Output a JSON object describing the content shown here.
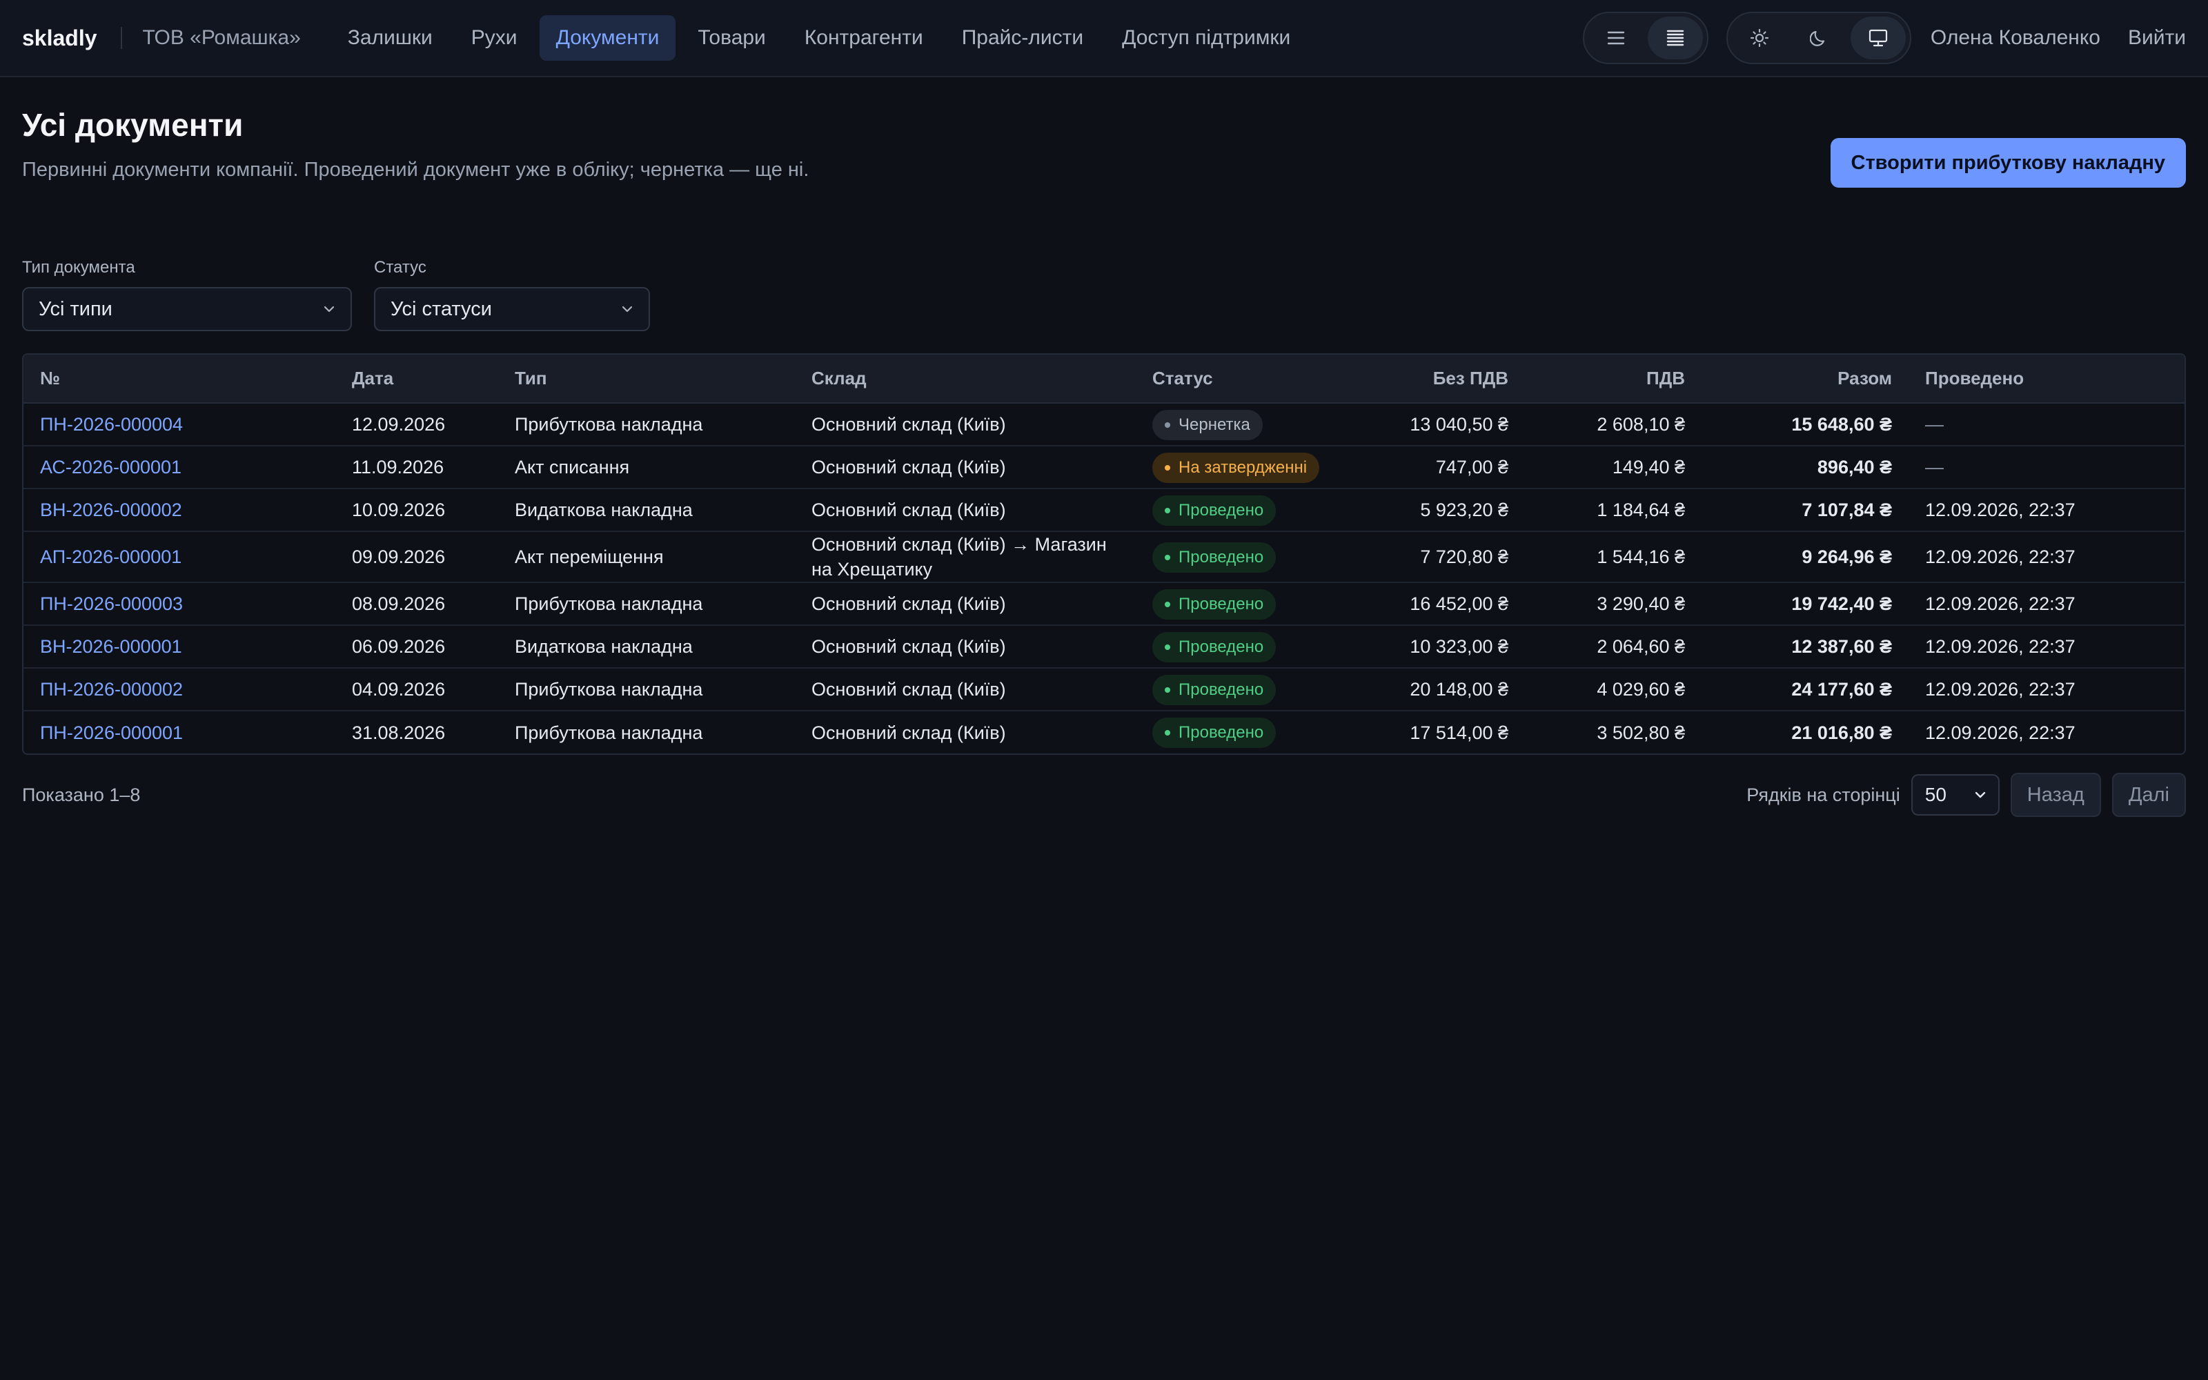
{
  "app": {
    "brand": "skladly",
    "company": "ТОВ «Ромашка»"
  },
  "nav": [
    {
      "label": "Залишки"
    },
    {
      "label": "Рухи"
    },
    {
      "label": "Документи"
    },
    {
      "label": "Товари"
    },
    {
      "label": "Контрагенти"
    },
    {
      "label": "Прайс-листи"
    },
    {
      "label": "Доступ підтримки"
    }
  ],
  "active_nav": "Документи",
  "density_toggle": {
    "selected": "compact",
    "options": [
      "list-icon",
      "compact-list-icon"
    ]
  },
  "theme_toggle": {
    "selected": "system",
    "options": [
      "sun-icon",
      "moon-icon",
      "monitor-icon"
    ]
  },
  "user": {
    "name": "Олена Коваленко",
    "logout": "Вийти"
  },
  "page": {
    "title": "Усі документи",
    "subtitle": "Первинні документи компанії. Проведений документ уже в обліку; чернетка — ще ні.",
    "create_button": "Створити прибуткову накладну"
  },
  "filters": {
    "type": {
      "label": "Тип документа",
      "value": "Усі типи"
    },
    "status": {
      "label": "Статус",
      "value": "Усі статуси"
    }
  },
  "table": {
    "columns": [
      "№",
      "Дата",
      "Тип",
      "Склад",
      "Статус",
      "Без ПДВ",
      "ПДВ",
      "Разом",
      "Проведено"
    ],
    "rows": [
      {
        "number": "ПН-2026-000004",
        "date": "12.09.2026",
        "type": "Прибуткова накладна",
        "warehouse": "Основний склад (Київ)",
        "status": "Чернетка",
        "status_kind": "draft",
        "net": "13 040,50 ₴",
        "vat": "2 608,10 ₴",
        "total": "15 648,60 ₴",
        "posted": "—"
      },
      {
        "number": "АС-2026-000001",
        "date": "11.09.2026",
        "type": "Акт списання",
        "warehouse": "Основний склад (Київ)",
        "status": "На затвердженні",
        "status_kind": "pending",
        "net": "747,00 ₴",
        "vat": "149,40 ₴",
        "total": "896,40 ₴",
        "posted": "—"
      },
      {
        "number": "ВН-2026-000002",
        "date": "10.09.2026",
        "type": "Видаткова накладна",
        "warehouse": "Основний склад (Київ)",
        "status": "Проведено",
        "status_kind": "posted",
        "net": "5 923,20 ₴",
        "vat": "1 184,64 ₴",
        "total": "7 107,84 ₴",
        "posted": "12.09.2026, 22:37"
      },
      {
        "number": "АП-2026-000001",
        "date": "09.09.2026",
        "type": "Акт переміщення",
        "warehouse": "Основний склад (Київ) → Магазин на Хрещатику",
        "status": "Проведено",
        "status_kind": "posted",
        "net": "7 720,80 ₴",
        "vat": "1 544,16 ₴",
        "total": "9 264,96 ₴",
        "posted": "12.09.2026, 22:37"
      },
      {
        "number": "ПН-2026-000003",
        "date": "08.09.2026",
        "type": "Прибуткова накладна",
        "warehouse": "Основний склад (Київ)",
        "status": "Проведено",
        "status_kind": "posted",
        "net": "16 452,00 ₴",
        "vat": "3 290,40 ₴",
        "total": "19 742,40 ₴",
        "posted": "12.09.2026, 22:37"
      },
      {
        "number": "ВН-2026-000001",
        "date": "06.09.2026",
        "type": "Видаткова накладна",
        "warehouse": "Основний склад (Київ)",
        "status": "Проведено",
        "status_kind": "posted",
        "net": "10 323,00 ₴",
        "vat": "2 064,60 ₴",
        "total": "12 387,60 ₴",
        "posted": "12.09.2026, 22:37"
      },
      {
        "number": "ПН-2026-000002",
        "date": "04.09.2026",
        "type": "Прибуткова накладна",
        "warehouse": "Основний склад (Київ)",
        "status": "Проведено",
        "status_kind": "posted",
        "net": "20 148,00 ₴",
        "vat": "4 029,60 ₴",
        "total": "24 177,60 ₴",
        "posted": "12.09.2026, 22:37"
      },
      {
        "number": "ПН-2026-000001",
        "date": "31.08.2026",
        "type": "Прибуткова накладна",
        "warehouse": "Основний склад (Київ)",
        "status": "Проведено",
        "status_kind": "posted",
        "net": "17 514,00 ₴",
        "vat": "3 502,80 ₴",
        "total": "21 016,80 ₴",
        "posted": "12.09.2026, 22:37"
      }
    ]
  },
  "footer": {
    "shown": "Показано 1–8",
    "rows_label": "Рядків на сторінці",
    "rows_value": "50",
    "prev": "Назад",
    "next": "Далі"
  },
  "colors": {
    "background": "#0d1017",
    "accent": "#6d97ff",
    "link": "#7fa6ff",
    "status_posted": "#4fcf85",
    "status_pending": "#f5b04a",
    "status_draft": "#8a93a3"
  }
}
